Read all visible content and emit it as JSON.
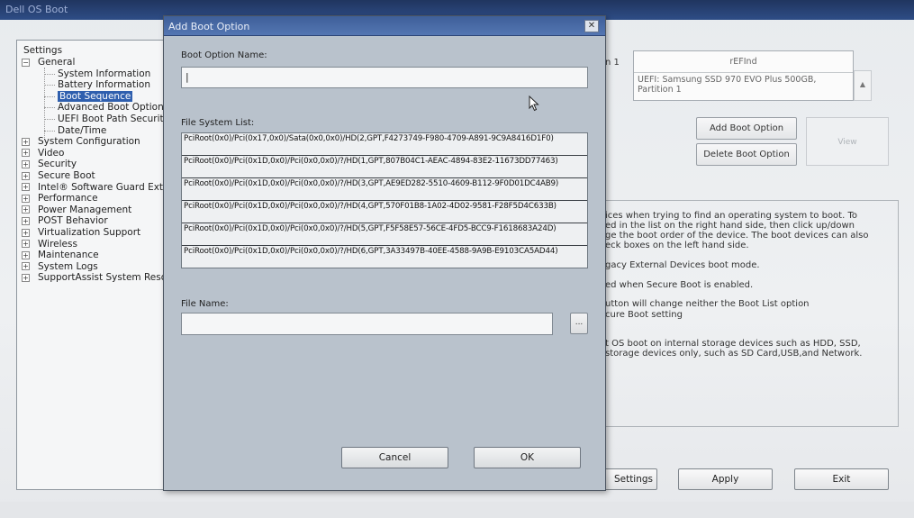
{
  "window": {
    "title": "Dell OS Boot"
  },
  "tree": {
    "root": "Settings",
    "items": [
      {
        "label": "General",
        "toggle": "−",
        "level": 1
      },
      {
        "label": "System Information",
        "level": 2
      },
      {
        "label": "Battery Information",
        "level": 2
      },
      {
        "label": "Boot Sequence",
        "level": 2,
        "selected": true
      },
      {
        "label": "Advanced Boot Options",
        "level": 2
      },
      {
        "label": "UEFI Boot Path Security",
        "level": 2
      },
      {
        "label": "Date/Time",
        "level": 2
      },
      {
        "label": "System Configuration",
        "toggle": "+",
        "level": 1
      },
      {
        "label": "Video",
        "toggle": "+",
        "level": 1
      },
      {
        "label": "Security",
        "toggle": "+",
        "level": 1
      },
      {
        "label": "Secure Boot",
        "toggle": "+",
        "level": 1
      },
      {
        "label": "Intel® Software Guard Extensions",
        "toggle": "+",
        "level": 1
      },
      {
        "label": "Performance",
        "toggle": "+",
        "level": 1
      },
      {
        "label": "Power Management",
        "toggle": "+",
        "level": 1
      },
      {
        "label": "POST Behavior",
        "toggle": "+",
        "level": 1
      },
      {
        "label": "Virtualization Support",
        "toggle": "+",
        "level": 1
      },
      {
        "label": "Wireless",
        "toggle": "+",
        "level": 1
      },
      {
        "label": "Maintenance",
        "toggle": "+",
        "level": 1
      },
      {
        "label": "System Logs",
        "toggle": "+",
        "level": 1
      },
      {
        "label": "SupportAssist System Resolution",
        "toggle": "+",
        "level": 1
      }
    ]
  },
  "bootlist": {
    "label_fragment": "n 1",
    "entry_name": "rEFInd",
    "entry_desc": "UEFI: Samsung SSD 970 EVO Plus 500GB, Partition 1"
  },
  "right_buttons": {
    "add": "Add Boot Option",
    "delete": "Delete Boot Option",
    "view": "View"
  },
  "help_lines": [
    "ices when trying to find an operating system to boot. To",
    "ed in the list on the right hand side, then click up/down",
    "ge the boot order of the device. The boot devices can also",
    "eck boxes on the left hand side.",
    "gacy External Devices boot mode.",
    "ed when Secure Boot is enabled.",
    "utton will change neither the Boot List option",
    "cure Boot setting",
    "t OS boot on internal storage devices such as HDD, SSD,",
    "storage devices only, such as SD Card,USB,and Network."
  ],
  "bottom_buttons": {
    "settings": "Settings",
    "apply": "Apply",
    "exit": "Exit"
  },
  "dialog": {
    "title": "Add Boot Option",
    "close": "✕",
    "boot_option_name_label": "Boot Option Name:",
    "boot_option_name_value": "|",
    "file_system_list_label": "File System List:",
    "file_systems": [
      "PciRoot(0x0)/Pci(0x17,0x0)/Sata(0x0,0x0)/HD(2,GPT,F4273749-F980-4709-A891-9C9A8416D1F0)",
      "PciRoot(0x0)/Pci(0x1D,0x0)/Pci(0x0,0x0)/?/HD(1,GPT,807B04C1-AEAC-4894-83E2-11673DD77463)",
      "PciRoot(0x0)/Pci(0x1D,0x0)/Pci(0x0,0x0)/?/HD(3,GPT,AE9ED282-5510-4609-B112-9F0D01DC4AB9)",
      "PciRoot(0x0)/Pci(0x1D,0x0)/Pci(0x0,0x0)/?/HD(4,GPT,570F01B8-1A02-4D02-9581-F28F5D4C633B)",
      "PciRoot(0x0)/Pci(0x1D,0x0)/Pci(0x0,0x0)/?/HD(5,GPT,F5F58E57-56CE-4FD5-BCC9-F1618683A24D)",
      "PciRoot(0x0)/Pci(0x1D,0x0)/Pci(0x0,0x0)/?/HD(6,GPT,3A33497B-40EE-4588-9A9B-E9103CA5AD44)"
    ],
    "file_name_label": "File Name:",
    "file_name_value": "",
    "browse": "...",
    "cancel": "Cancel",
    "ok": "OK"
  }
}
